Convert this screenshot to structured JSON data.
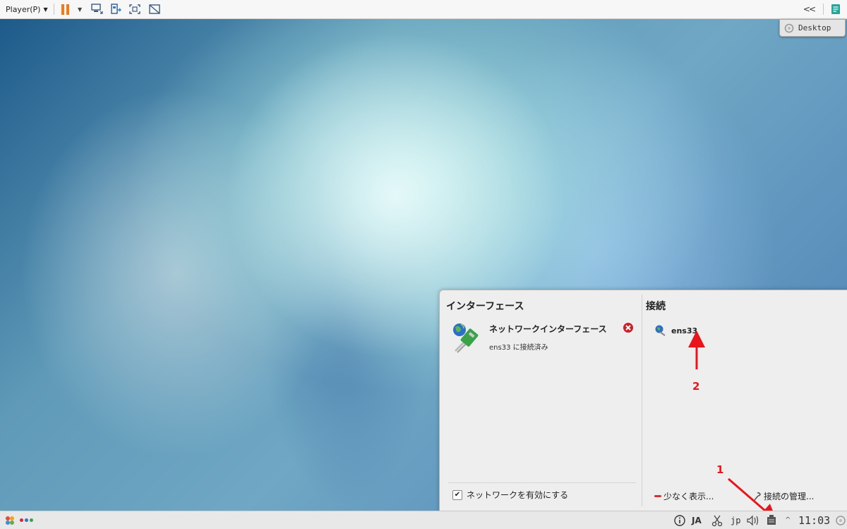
{
  "vm_toolbar": {
    "player_menu": "Player(P)",
    "icons": [
      "pause-icon",
      "send-ctrl-alt-del-icon",
      "removable-devices-icon",
      "full-screen-icon",
      "unity-icon",
      "collapse-icon",
      "notes-icon"
    ]
  },
  "desktop": {
    "switcher_label": "Desktop"
  },
  "network_popup": {
    "interfaces_title": "インターフェース",
    "interface_name": "ネットワークインターフェース",
    "interface_status": "ens33 に接続済み",
    "enable_network_label": "ネットワークを有効にする",
    "enable_network_checked": true,
    "connections_title": "接続",
    "connection_name": "ens33",
    "show_less_label": "少なく表示...",
    "manage_connections_label": "接続の管理..."
  },
  "annotations": {
    "marker_1": "1",
    "marker_2": "2",
    "color": "#e8161c"
  },
  "taskbar": {
    "lang_label": "JA",
    "keyboard_label": "jp",
    "clock": "11:03"
  }
}
